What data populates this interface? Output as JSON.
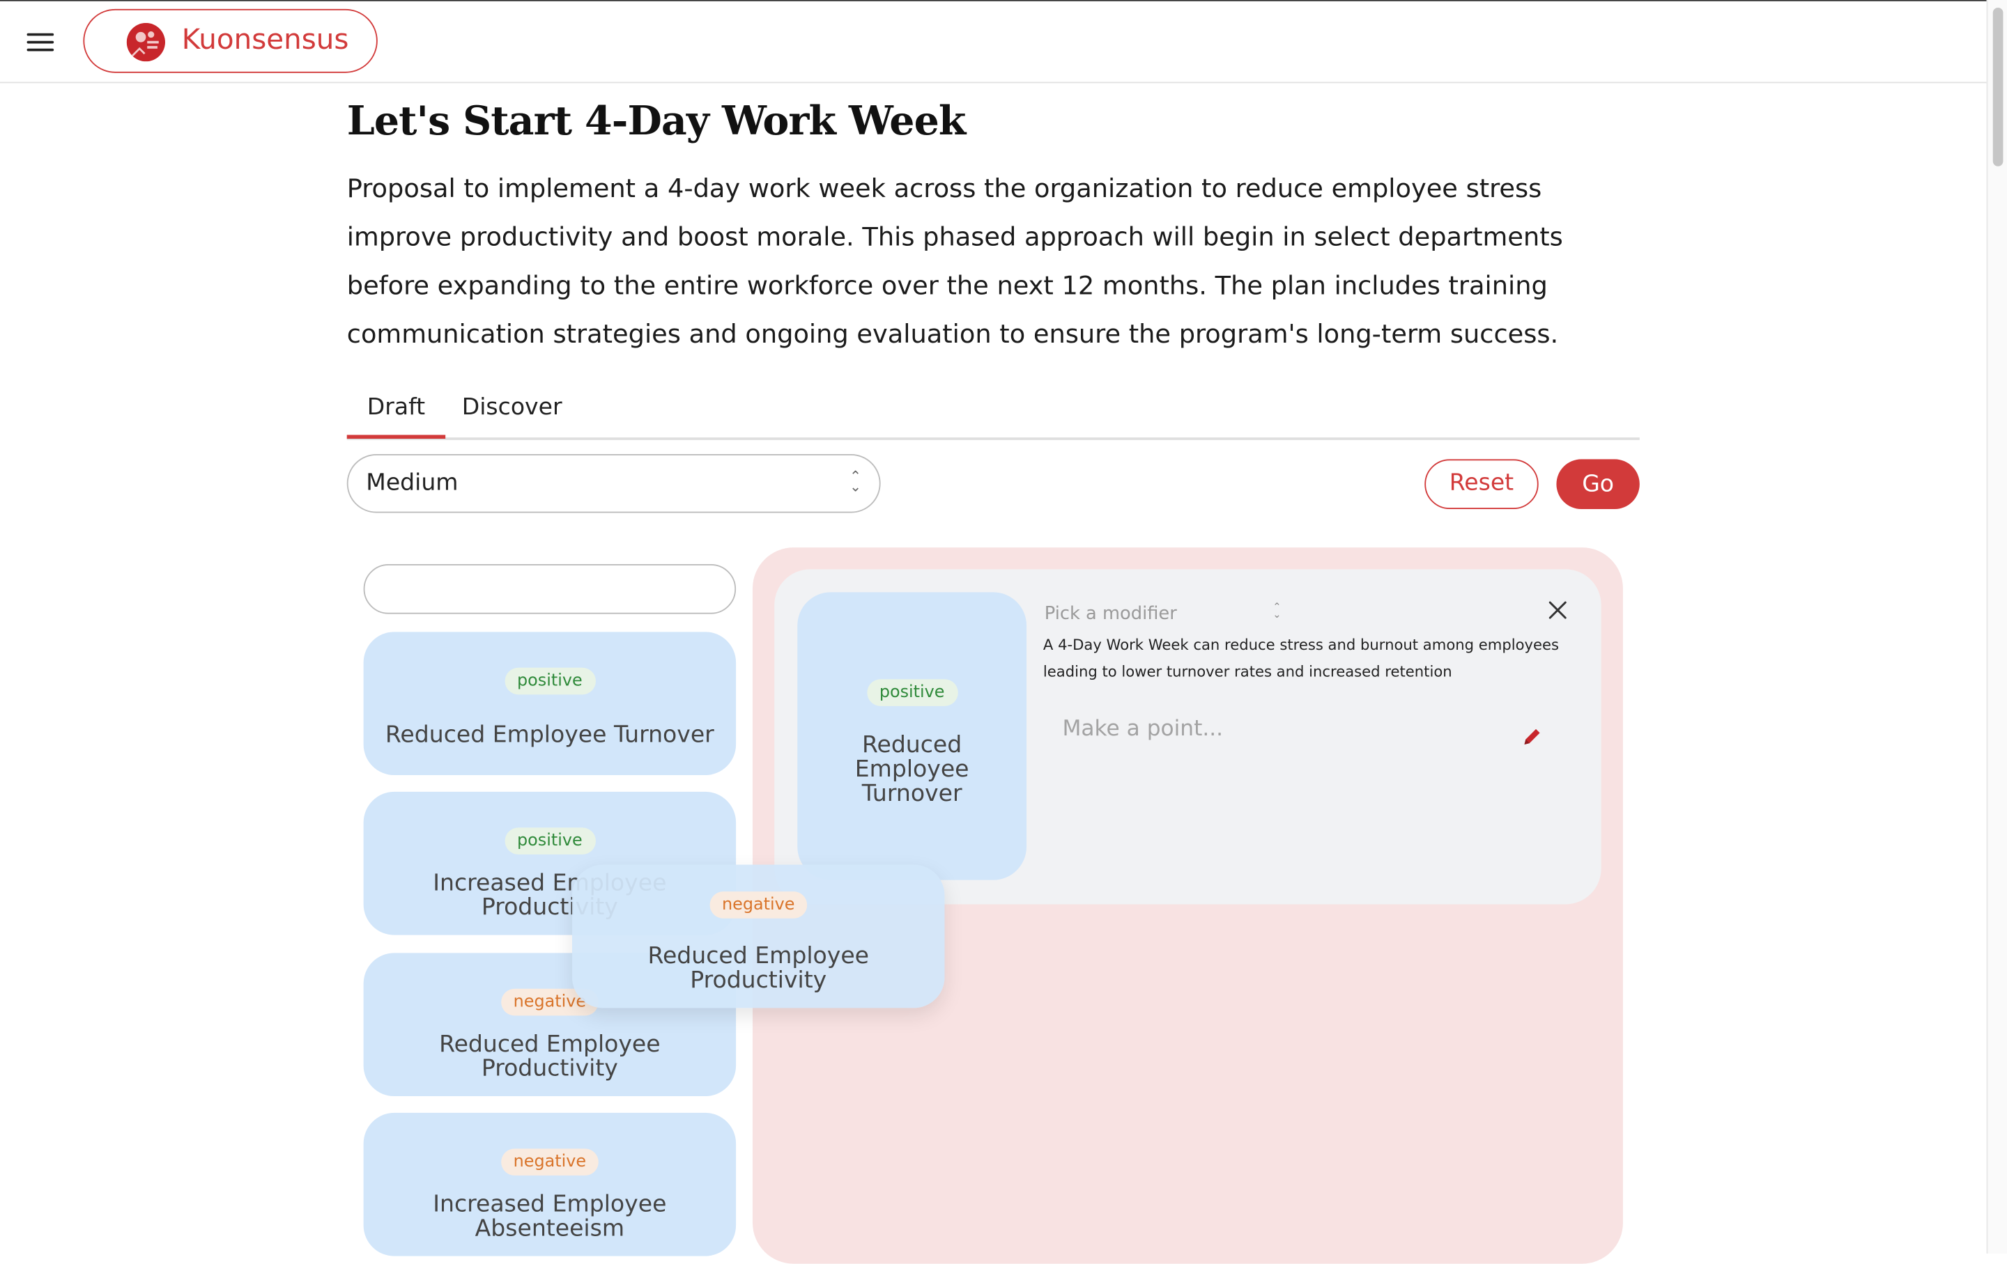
{
  "app": {
    "name": "Kuonsensus",
    "colors": {
      "accent": "#d23a3a",
      "card": "#d2e6fa",
      "dropzone": "#f8e2e2",
      "panel": "#f1f2f4",
      "positive": "#2f8a3a",
      "negative": "#d9742a"
    }
  },
  "header": {
    "menu_icon": "hamburger-icon",
    "brand_label": "Kuonsensus",
    "logo_icon": "kuonsensus-logo-icon"
  },
  "proposal": {
    "title": "Let's Start 4-Day Work Week",
    "description": "Proposal to implement a 4-day work week across the organization to reduce employee stress improve productivity and boost morale. This phased approach will begin in select departments before expanding to the entire workforce over the next 12 months. The plan includes training communication strategies and ongoing evaluation to ensure the program's long-term success."
  },
  "tabs": [
    {
      "label": "Draft",
      "active": true
    },
    {
      "label": "Discover",
      "active": false
    }
  ],
  "controls": {
    "level_select": "Medium",
    "reset_label": "Reset",
    "go_label": "Go"
  },
  "filter": {
    "value": "",
    "placeholder": ""
  },
  "cards": [
    {
      "tag": "positive",
      "title": "Reduced Employee Turnover"
    },
    {
      "tag": "positive",
      "title": "Increased Employee Productivity"
    },
    {
      "tag": "negative",
      "title": "Reduced Employee Productivity"
    },
    {
      "tag": "negative",
      "title": "Increased Employee Absenteeism"
    }
  ],
  "dragging_card": {
    "tag": "negative",
    "title": "Reduced Employee Productivity"
  },
  "panel": {
    "card": {
      "tag": "positive",
      "title": "Reduced Employee Turnover"
    },
    "modifier_placeholder": "Pick a modifier",
    "description": "A 4-Day Work Week can reduce stress and burnout among employees leading to lower turnover rates and increased retention",
    "point_placeholder": "Make a point..."
  }
}
